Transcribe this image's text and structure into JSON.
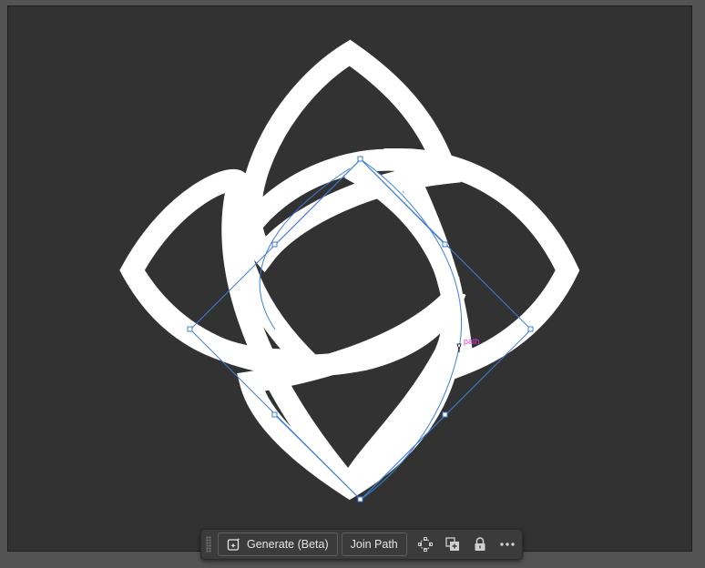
{
  "canvas": {
    "path_label": "path",
    "colors": {
      "pasteboard": "#535353",
      "artboard": "#323232",
      "shape": "#ffffff",
      "selection": "#3d7fd6",
      "smart_guide": "#e53ee5"
    }
  },
  "context_bar": {
    "generate_label": "Generate (Beta)",
    "join_label": "Join Path",
    "icons": [
      "drag-handle-icon",
      "generate-sparkle-icon",
      "anchor-points-icon",
      "duplicate-icon",
      "lock-icon",
      "more-options-icon"
    ]
  }
}
